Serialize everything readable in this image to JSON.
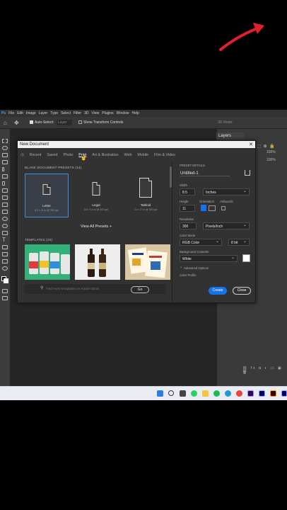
{
  "menubar": [
    "Ps",
    "File",
    "Edit",
    "Image",
    "Layer",
    "Type",
    "Select",
    "Filter",
    "3D",
    "View",
    "Plugins",
    "Window",
    "Help"
  ],
  "optionsbar": {
    "auto_select": "Auto-Select:",
    "layer_value": "Layer",
    "transform_controls": "Show Transform Controls",
    "mode_3d": "3D Mode:"
  },
  "right_panel": {
    "tab": "Layers",
    "opacity_value": "100%",
    "fill_value": "100%"
  },
  "dialog": {
    "title": "New Document",
    "tabs": [
      "Recent",
      "Saved",
      "Photo",
      "Print",
      "Art & Illustration",
      "Web",
      "Mobile",
      "Film & Video"
    ],
    "active_tab": "Print",
    "blank_presets_label": "BLANK DOCUMENT PRESETS (14)",
    "presets": [
      {
        "name": "Letter",
        "dims": "8.5 x 11 in @ 300 ppi"
      },
      {
        "name": "Legal",
        "dims": "8.5 x 14 in @ 300 ppi"
      },
      {
        "name": "Tabloid",
        "dims": "11 x 17 in @ 300 ppi"
      }
    ],
    "view_all": "View All Presets +",
    "templates_label": "TEMPLATES (20)",
    "search_placeholder": "Find more templates on Adobe Stock",
    "go_label": "Go",
    "details": {
      "header": "PRESET DETAILS",
      "doc_name": "Untitled-1",
      "width_label": "Width",
      "width_value": "8.5",
      "width_unit": "Inches",
      "height_label": "Height",
      "height_value": "11",
      "orientation_label": "Orientation",
      "artboards_label": "Artboards",
      "resolution_label": "Resolution",
      "resolution_value": "300",
      "resolution_unit": "Pixels/Inch",
      "color_mode_label": "Color Mode",
      "color_mode_value": "RGB Color",
      "bit_depth": "8 bit",
      "background_label": "Background Contents",
      "background_value": "White",
      "advanced_label": "Advanced Options",
      "color_profile_label": "Color Profile"
    },
    "create_label": "Create",
    "close_label": "Close"
  },
  "colors": {
    "accent": "#1473e6",
    "arrow": "#e0202a",
    "selection": "#3d8ee6"
  }
}
